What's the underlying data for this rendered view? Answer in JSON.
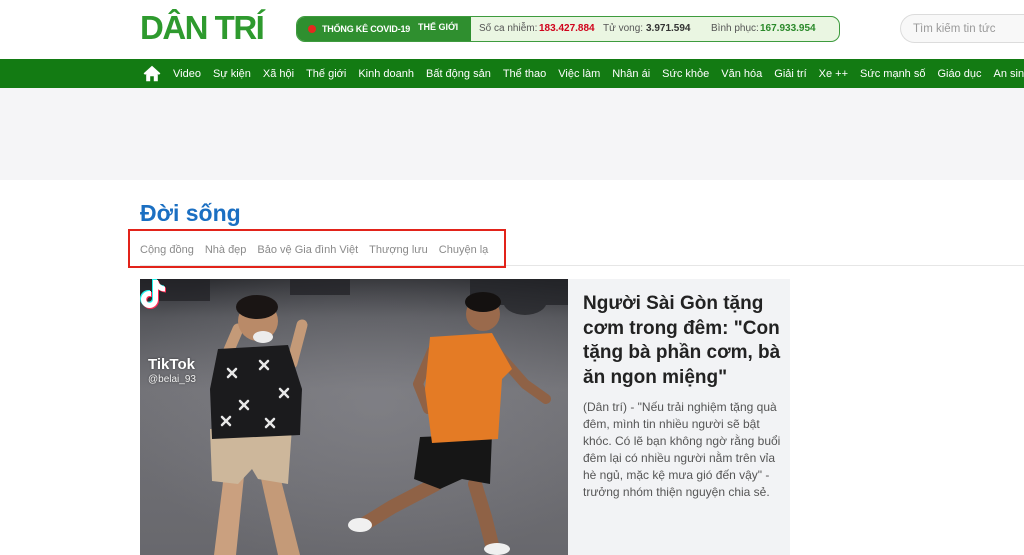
{
  "header": {
    "logo_text": "DÂN TRÍ",
    "covid": {
      "live_icon": "live-dot-icon",
      "title": "THỐNG KÊ COVID-19",
      "scope": "THẾ GIỚI",
      "cases_label": "Số ca nhiễm:",
      "cases_value": "183.427.884",
      "deaths_label": "Tử vong:",
      "deaths_value": "3.971.594",
      "recovered_label": "Bình phục:",
      "recovered_value": "167.933.954"
    },
    "search": {
      "placeholder": "Tìm kiếm tin tức"
    }
  },
  "nav": {
    "home_icon": "home-icon",
    "items": [
      "Video",
      "Sự kiện",
      "Xã hội",
      "Thế giới",
      "Kinh doanh",
      "Bất động sản",
      "Thể thao",
      "Việc làm",
      "Nhân ái",
      "Sức khỏe",
      "Văn hóa",
      "Giải trí",
      "Xe ++",
      "Sức mạnh số",
      "Giáo dục",
      "An sinh"
    ]
  },
  "section": {
    "title": "Đời sống",
    "subcategories": [
      "Cộng đồng",
      "Nhà đẹp",
      "Bảo vệ Gia đình Việt",
      "Thượng lưu",
      "Chuyện lạ"
    ]
  },
  "featured_article": {
    "image": {
      "watermark_icon": "tiktok-logo-icon",
      "watermark_brand": "TikTok",
      "watermark_handle": "@belai_93"
    },
    "title": "Người Sài Gòn tặng cơm trong đêm: \"Con tặng bà phần cơm, bà ăn ngon miệng\"",
    "summary": "(Dân trí) - \"Nếu trải nghiệm tặng quà đêm, mình tin nhiều người sẽ bật khóc. Có lẽ bạn không ngờ rằng buổi đêm lại có nhiều người nằm trên vỉa hè ngủ, mặc kệ mưa gió đến vậy\" - trưởng nhóm thiện nguyện chia sẻ."
  },
  "colors": {
    "brand_green": "#2e9a2e",
    "nav_green": "#137b13",
    "section_title_blue": "#1b6fc2",
    "cases_red": "#d0021b",
    "recovered_green": "#2b8a2b",
    "highlight_red": "#e2231a"
  }
}
